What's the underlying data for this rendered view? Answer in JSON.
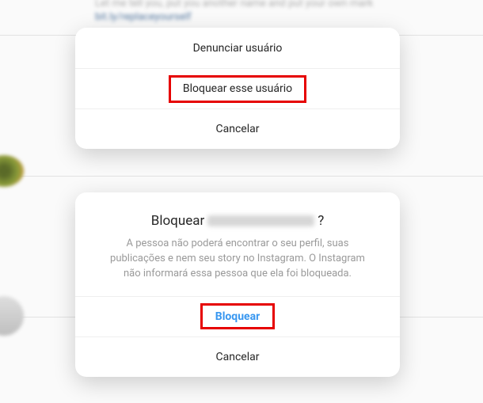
{
  "background": {
    "top_text": "Let me tell you, put you another name and put your own mark",
    "link_text": "bit.ly/replaceyourself"
  },
  "modal1": {
    "report_label": "Denunciar usuário",
    "block_label": "Bloquear esse usuário",
    "cancel_label": "Cancelar"
  },
  "modal2": {
    "title_prefix": "Bloquear",
    "title_suffix": "?",
    "description": "A pessoa não poderá encontrar o seu perfil, suas publicações e nem seu story no Instagram. O Instagram não informará essa pessoa que ela foi bloqueada.",
    "block_label": "Bloquear",
    "cancel_label": "Cancelar"
  }
}
